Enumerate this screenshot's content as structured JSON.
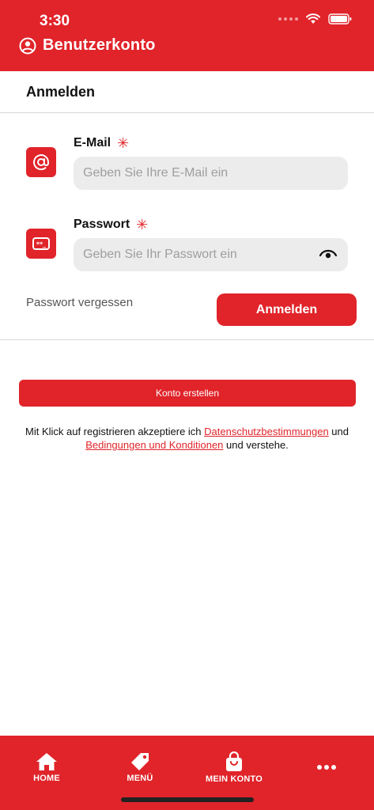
{
  "status_bar": {
    "time": "3:30"
  },
  "header": {
    "title": "Benutzerkonto",
    "accent": "#e0242a"
  },
  "section": {
    "title": "Anmelden"
  },
  "form": {
    "email_label": "E-Mail",
    "email_placeholder": "Geben Sie Ihre E-Mail ein",
    "email_value": "",
    "password_label": "Passwort",
    "password_placeholder": "Geben Sie Ihr Passwort ein",
    "password_value": "",
    "required_mark": "✳",
    "forgot_label": "Passwort vergessen",
    "login_label": "Anmelden"
  },
  "create_account": {
    "label": "Konto erstellen"
  },
  "terms": {
    "prefix": "Mit Klick auf registrieren akzeptiere ich ",
    "privacy_link": "Datenschutzbestimmungen",
    "middle": " und",
    "conditions_link": "Bedingungen und Konditionen",
    "suffix": " und verstehe."
  },
  "bottom_nav": {
    "items": [
      {
        "label": "HOME",
        "icon": "home-icon"
      },
      {
        "label": "MENÜ",
        "icon": "tag-icon"
      },
      {
        "label": "MEIN KONTO",
        "icon": "shopping-bag-icon"
      },
      {
        "label": "",
        "icon": "more-icon"
      }
    ]
  }
}
